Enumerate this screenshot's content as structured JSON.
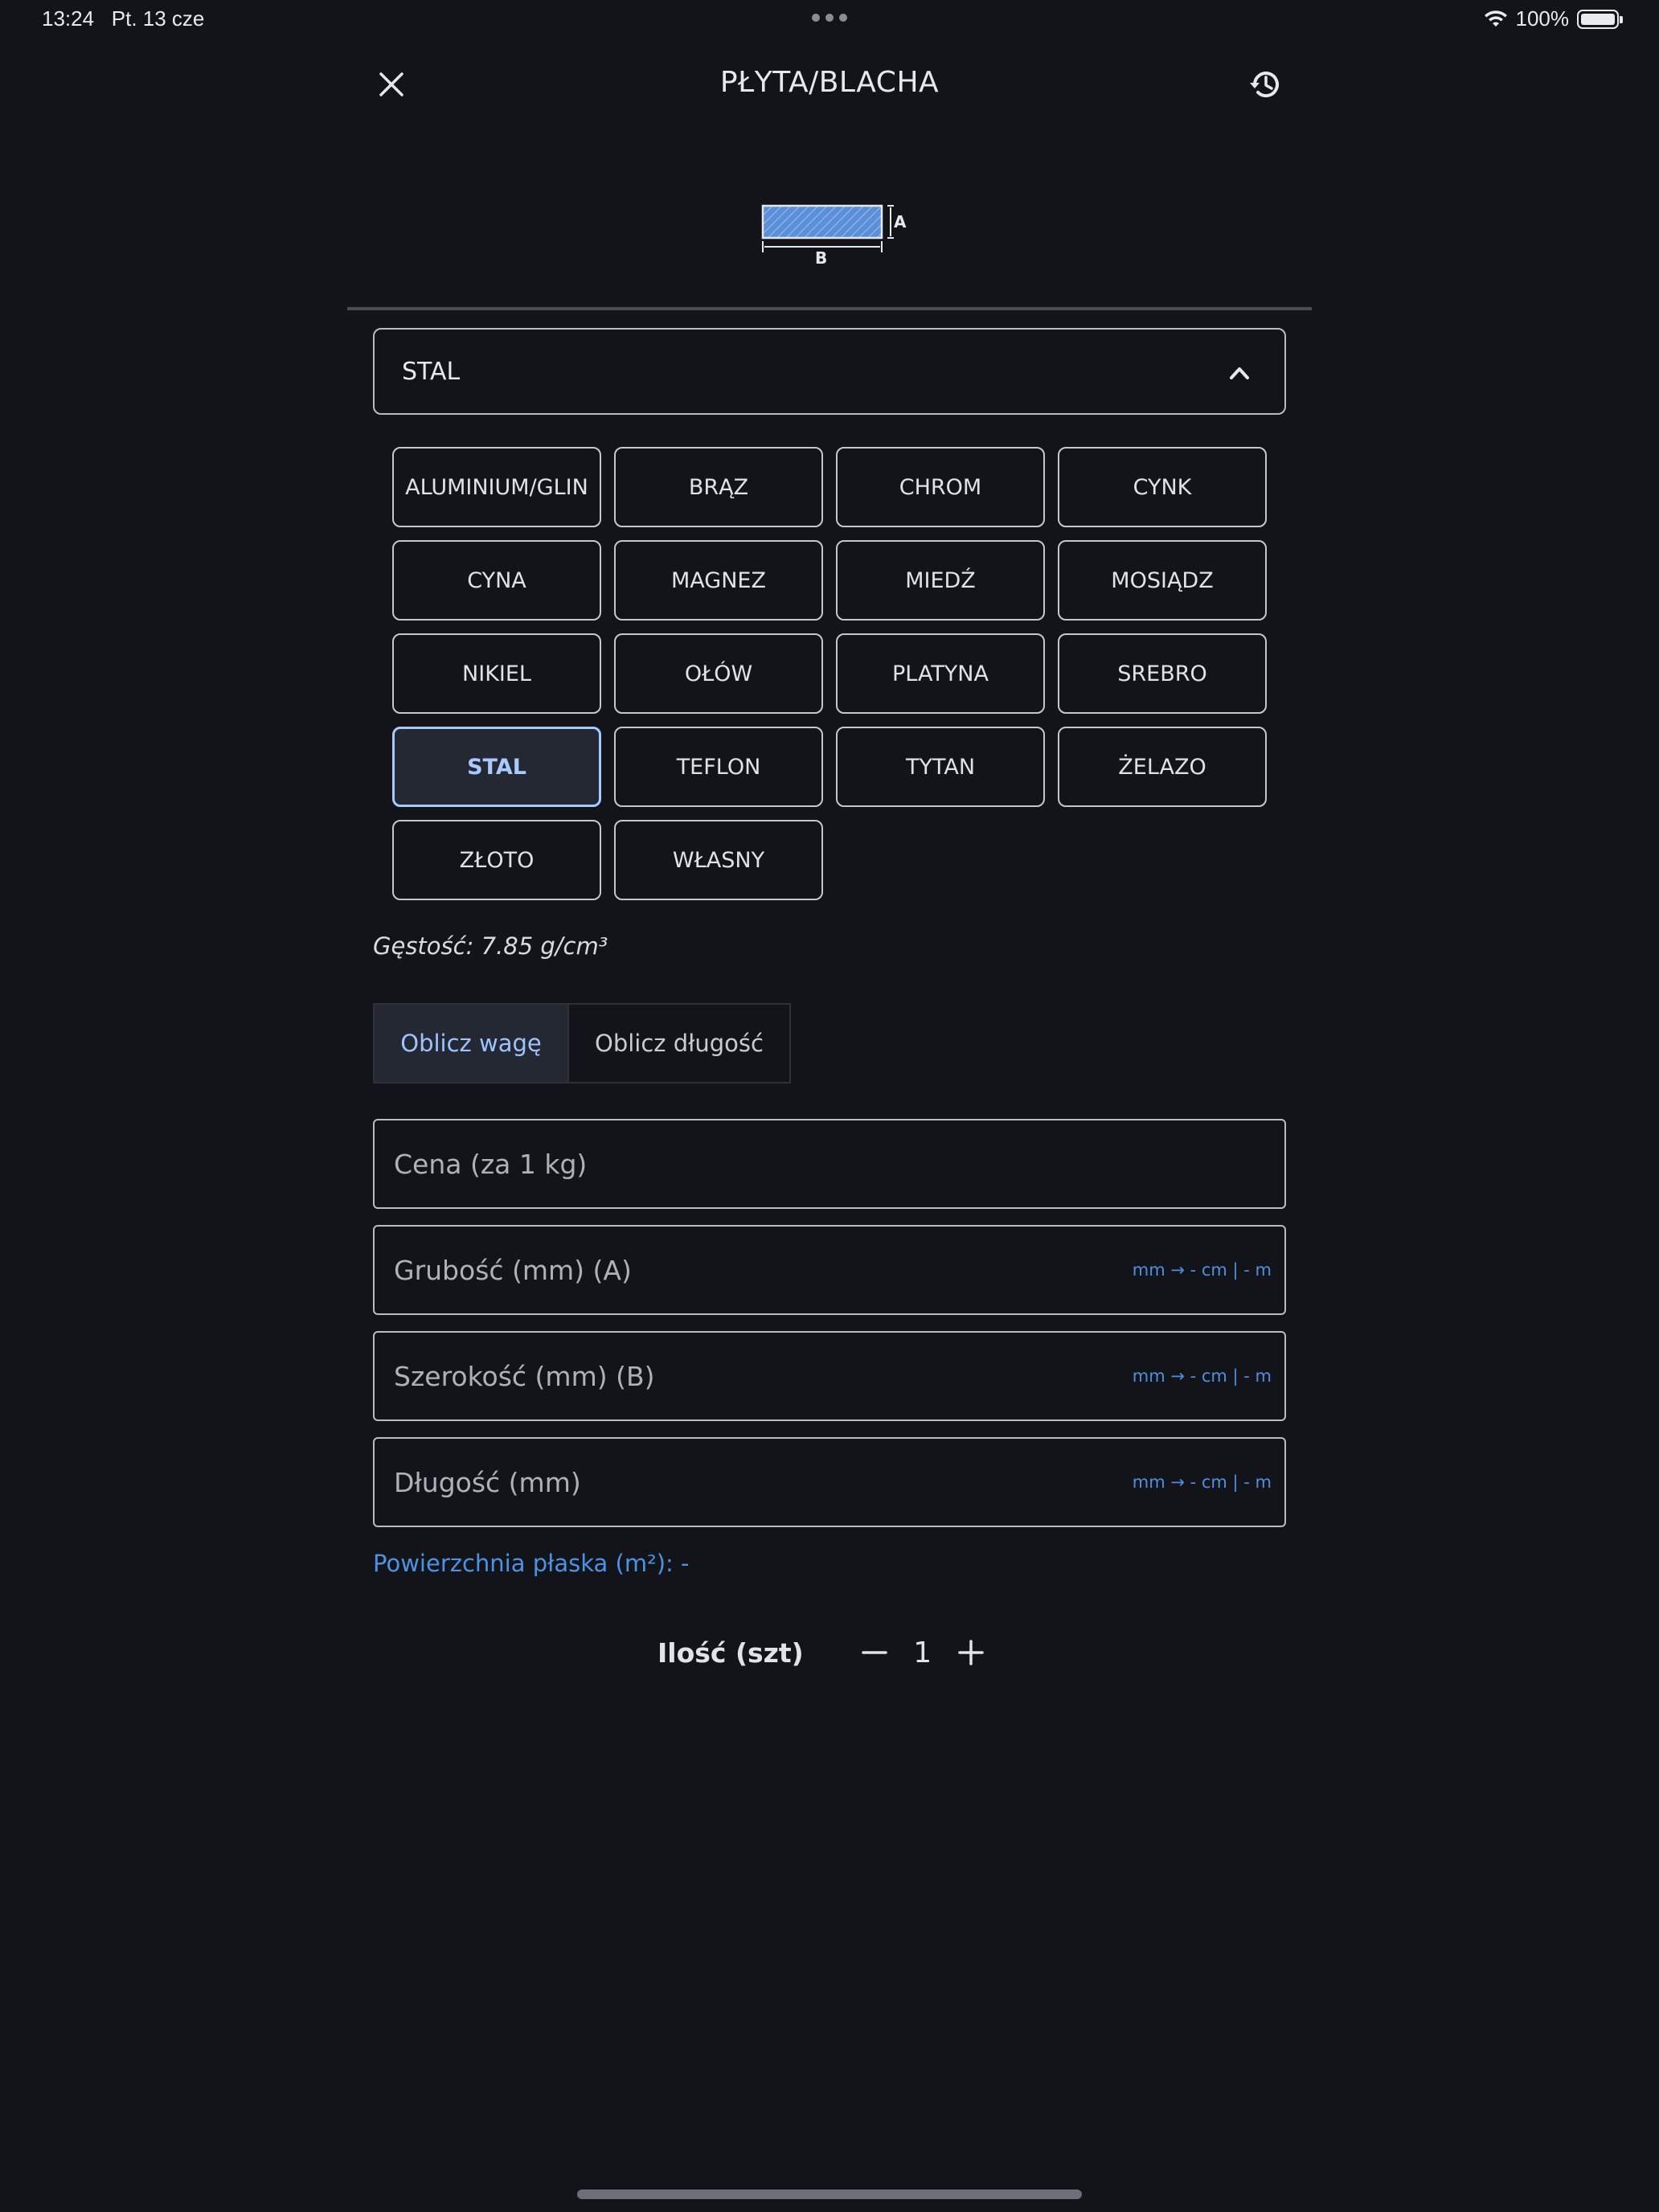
{
  "status_bar": {
    "time": "13:24",
    "date": "Pt. 13 cze",
    "battery": "100%"
  },
  "header": {
    "title": "PŁYTA/BLACHA",
    "close_icon": "close-icon",
    "history_icon": "history-icon"
  },
  "diagram": {
    "label_a": "A",
    "label_b": "B",
    "fill_color": "#5b8fd8"
  },
  "material_select": {
    "value": "STAL"
  },
  "materials": [
    {
      "label": "ALUMINIUM/GLIN"
    },
    {
      "label": "BRĄZ"
    },
    {
      "label": "CHROM"
    },
    {
      "label": "CYNK"
    },
    {
      "label": "CYNA"
    },
    {
      "label": "MAGNEZ"
    },
    {
      "label": "MIEDŹ"
    },
    {
      "label": "MOSIĄDZ"
    },
    {
      "label": "NIKIEL"
    },
    {
      "label": "OŁÓW"
    },
    {
      "label": "PLATYNA"
    },
    {
      "label": "SREBRO"
    },
    {
      "label": "STAL",
      "selected": true
    },
    {
      "label": "TEFLON"
    },
    {
      "label": "TYTAN"
    },
    {
      "label": "ŻELAZO"
    },
    {
      "label": "ZŁOTO"
    },
    {
      "label": "WŁASNY"
    }
  ],
  "density": "Gęstość: 7.85 g/cm³",
  "tabs": {
    "weight": "Oblicz wagę",
    "length": "Oblicz długość"
  },
  "fields": {
    "price": {
      "placeholder": "Cena (za 1 kg)"
    },
    "thickness": {
      "placeholder": "Grubość (mm) (A)",
      "unit": "mm → - cm | - m"
    },
    "width": {
      "placeholder": "Szerokość (mm) (B)",
      "unit": "mm → - cm | - m"
    },
    "length": {
      "placeholder": "Długość (mm)",
      "unit": "mm → - cm | - m"
    }
  },
  "area": "Powierzchnia płaska (m²): -",
  "quantity": {
    "label": "Ilość (szt)",
    "value": "1"
  },
  "colors": {
    "background": "#121419",
    "accent": "#9fc3ff",
    "link": "#4c93e6"
  }
}
